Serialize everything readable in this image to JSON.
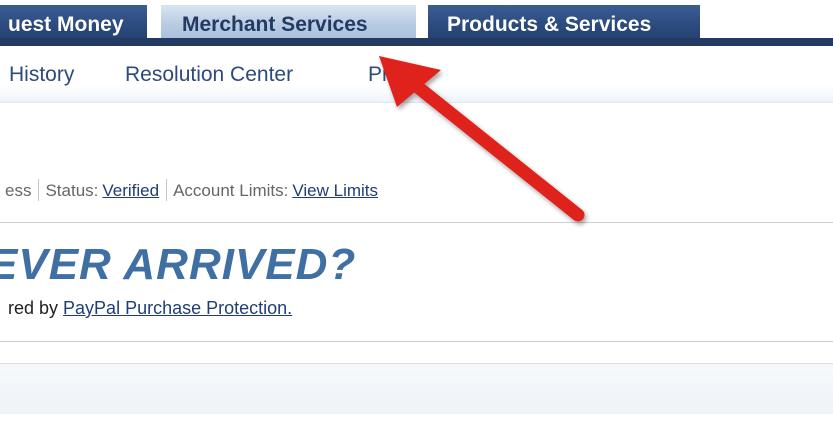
{
  "tabs": [
    {
      "label": "uest Money"
    },
    {
      "label": "Merchant Services"
    },
    {
      "label": "Products & Services"
    }
  ],
  "subnav": [
    {
      "label": "History"
    },
    {
      "label": "Resolution Center"
    },
    {
      "label": "Profile"
    }
  ],
  "status": {
    "partial_text": "ess",
    "status_label": "Status:",
    "status_value": "Verified",
    "limits_label": "Account Limits:",
    "limits_link": "View Limits"
  },
  "promo": {
    "title": "EVER ARRIVED?",
    "subtitle_prefix": "red by",
    "subtitle_link": "PayPal Purchase Protection."
  },
  "colors": {
    "tab_dark": "#2b4a7d",
    "tab_active": "#b8cbe2",
    "link": "#1f3d78",
    "promo_title": "#3f6fa3",
    "annotation_arrow": "#e0201a"
  }
}
